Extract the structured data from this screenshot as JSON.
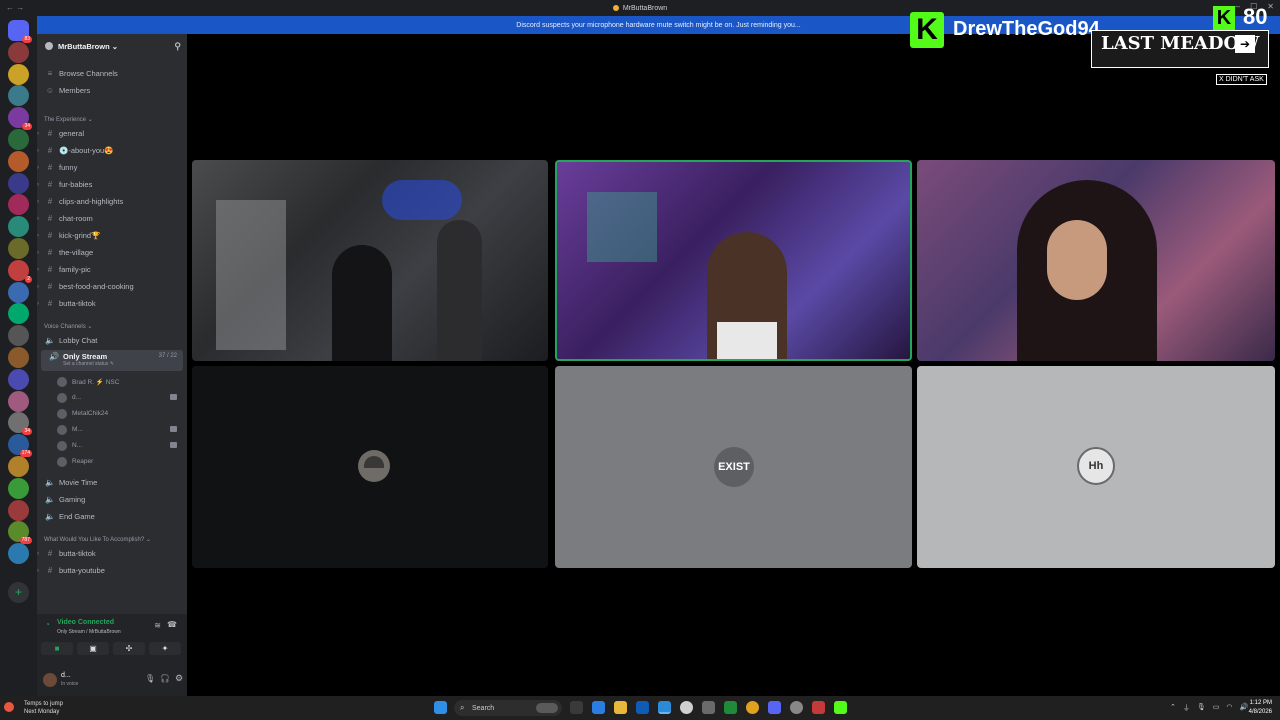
{
  "window": {
    "title": "MrButtaBrown",
    "notice": "Discord suspects your microphone hardware mute switch might be on. Just reminding you..."
  },
  "server": {
    "name": "MrButtaBrown ⌄",
    "top_items": [
      {
        "icon": "browse-icon",
        "label": "Browse Channels"
      },
      {
        "icon": "members-icon",
        "label": "Members"
      }
    ],
    "category_experience": "The Experience ⌄",
    "text_channels": [
      "general",
      "💿-about-you😍",
      "funny",
      "fur-babies",
      "clips-and-highlights",
      "chat-room",
      "kick-grind🏆",
      "the-village",
      "family-pic",
      "best-food-and-cooking",
      "butta-tiktok"
    ],
    "category_voice": "Voice Channels ⌄",
    "voice_channels_top": [
      "Lobby Chat"
    ],
    "selected_voice": {
      "name": "Only Stream",
      "count": "37 / 22",
      "status": "Set a channel status ✎"
    },
    "voice_users": [
      {
        "name": "Brad R. ⚡ NSC",
        "camera": false
      },
      {
        "name": "d...",
        "camera": true
      },
      {
        "name": "MetalChik24",
        "camera": false
      },
      {
        "name": "M...",
        "camera": true
      },
      {
        "name": "N...",
        "camera": true
      },
      {
        "name": "Reaper",
        "camera": false
      }
    ],
    "voice_channels_bottom": [
      "Movie Time",
      "Gaming",
      "End Game"
    ],
    "category_accomplish": "What Would You Like To Accomplish? ⌄",
    "accomplish_channels": [
      "butta-tiktok",
      "butta-youtube"
    ]
  },
  "voice_panel": {
    "status": "Video Connected",
    "subtitle": "Only Stream / MrButtaBrown",
    "user_name": "d...",
    "user_status": "In voice"
  },
  "overlay": {
    "kick_letter": "K",
    "streamer": "DrewTheGod94",
    "viewer_count": "80",
    "meadow": "LAST MEADOW",
    "ask_label": "X DIDN'T ASK"
  },
  "tiles": {
    "tile4_label": "",
    "tile5_logo": "EXIST",
    "tile6_logo": "Hh"
  },
  "taskbar": {
    "weather_title": "Temps to jump",
    "weather_sub": "Next Monday",
    "search": "Search",
    "time": "1:12 PM",
    "date": "4/8/2026"
  },
  "guild_badges": [
    "83",
    "",
    "",
    "",
    "34",
    "",
    "",
    "",
    "",
    "",
    "",
    "2",
    "",
    "",
    "",
    "",
    "",
    "",
    "34",
    "174",
    "",
    "",
    "",
    "787",
    ""
  ]
}
